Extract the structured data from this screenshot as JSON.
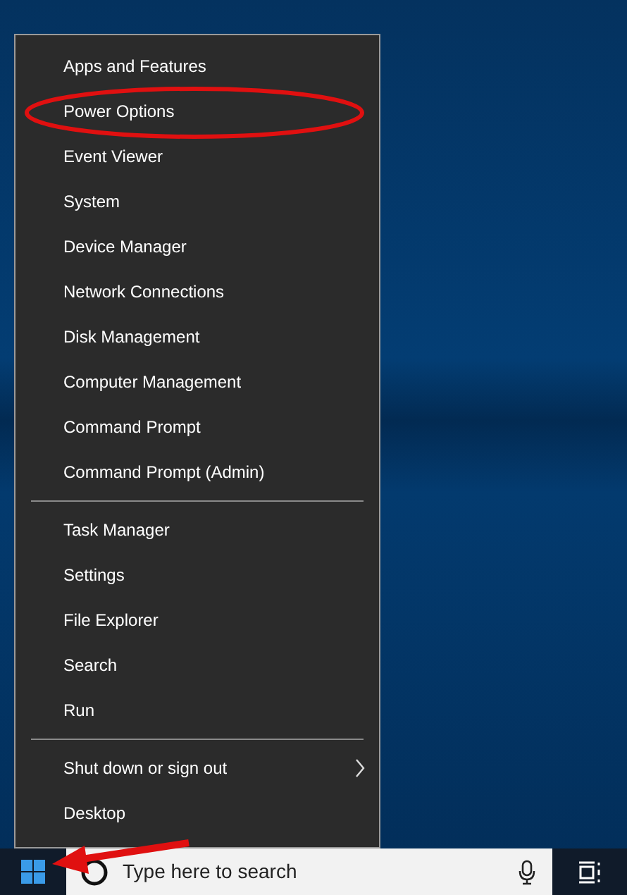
{
  "menu": {
    "groups": [
      {
        "items": [
          {
            "label": "Apps and Features",
            "submenu": false
          },
          {
            "label": "Power Options",
            "submenu": false,
            "circled": true
          },
          {
            "label": "Event Viewer",
            "submenu": false
          },
          {
            "label": "System",
            "submenu": false
          },
          {
            "label": "Device Manager",
            "submenu": false
          },
          {
            "label": "Network Connections",
            "submenu": false
          },
          {
            "label": "Disk Management",
            "submenu": false
          },
          {
            "label": "Computer Management",
            "submenu": false
          },
          {
            "label": "Command Prompt",
            "submenu": false
          },
          {
            "label": "Command Prompt (Admin)",
            "submenu": false
          }
        ]
      },
      {
        "items": [
          {
            "label": "Task Manager",
            "submenu": false
          },
          {
            "label": "Settings",
            "submenu": false
          },
          {
            "label": "File Explorer",
            "submenu": false
          },
          {
            "label": "Search",
            "submenu": false
          },
          {
            "label": "Run",
            "submenu": false
          }
        ]
      },
      {
        "items": [
          {
            "label": "Shut down or sign out",
            "submenu": true
          },
          {
            "label": "Desktop",
            "submenu": false
          }
        ]
      }
    ]
  },
  "taskbar": {
    "start_button": {
      "arrow_pointing": true
    },
    "search": {
      "placeholder": "Type here to search"
    }
  }
}
